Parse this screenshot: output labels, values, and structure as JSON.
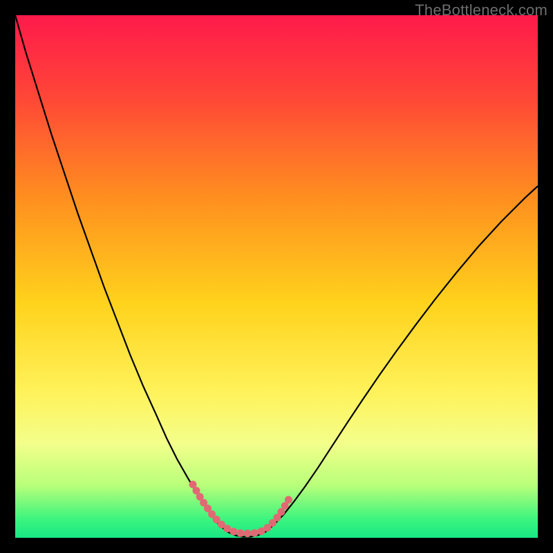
{
  "watermark": "TheBottleneck.com",
  "chart_data": {
    "type": "line",
    "title": "",
    "xlabel": "",
    "ylabel": "",
    "xlim": [
      0,
      100
    ],
    "ylim": [
      0,
      100
    ],
    "grid": false,
    "legend": false,
    "gradient_stops": [
      {
        "offset": 0.0,
        "color": "#ff1a4b"
      },
      {
        "offset": 0.15,
        "color": "#ff4438"
      },
      {
        "offset": 0.35,
        "color": "#ff8f1f"
      },
      {
        "offset": 0.55,
        "color": "#ffd21c"
      },
      {
        "offset": 0.72,
        "color": "#fff25a"
      },
      {
        "offset": 0.82,
        "color": "#f3ff8a"
      },
      {
        "offset": 0.9,
        "color": "#b8ff7a"
      },
      {
        "offset": 0.965,
        "color": "#3bf47e"
      },
      {
        "offset": 1.0,
        "color": "#18e884"
      }
    ],
    "series": [
      {
        "name": "bottleneck-curve",
        "stroke": "#000000",
        "stroke_width": 2.2,
        "x": [
          0.0,
          2.0,
          4.5,
          7.0,
          9.5,
          12.0,
          14.5,
          17.0,
          19.5,
          22.0,
          24.5,
          27.0,
          29.0,
          31.0,
          33.0,
          34.8,
          36.4,
          37.8,
          39.0,
          40.5,
          42.0,
          43.5,
          45.0,
          46.5,
          48.0,
          49.6,
          51.4,
          53.4,
          55.6,
          58.0,
          60.6,
          63.4,
          66.4,
          69.6,
          73.0,
          76.6,
          80.4,
          84.4,
          88.6,
          93.0,
          97.5,
          100.0
        ],
        "y": [
          100.0,
          93.0,
          85.0,
          77.0,
          69.5,
          62.0,
          55.0,
          48.0,
          41.5,
          35.0,
          29.0,
          23.5,
          19.0,
          15.0,
          11.5,
          8.5,
          6.0,
          4.0,
          2.5,
          1.2,
          0.5,
          0.2,
          0.2,
          0.5,
          1.2,
          2.6,
          4.5,
          7.0,
          10.0,
          13.5,
          17.5,
          21.8,
          26.3,
          31.0,
          35.8,
          40.7,
          45.7,
          50.7,
          55.7,
          60.5,
          65.0,
          67.3
        ]
      },
      {
        "name": "optimal-band-marker",
        "stroke": "#e06a74",
        "stroke_width": 11,
        "linecap": "round",
        "dotted": true,
        "dot_spacing": 1.35,
        "x": [
          34.0,
          35.0,
          36.0,
          37.0,
          37.8,
          38.6,
          39.4,
          40.2,
          41.0,
          42.0,
          43.0,
          44.0,
          45.0,
          46.0,
          47.0,
          48.0,
          48.8,
          49.6,
          50.4,
          51.2,
          52.0,
          53.0
        ],
        "y": [
          10.2,
          8.4,
          6.8,
          5.4,
          4.3,
          3.4,
          2.6,
          2.0,
          1.5,
          1.1,
          0.9,
          0.85,
          0.85,
          0.95,
          1.2,
          1.7,
          2.4,
          3.2,
          4.2,
          5.4,
          6.8,
          8.4
        ]
      }
    ]
  }
}
